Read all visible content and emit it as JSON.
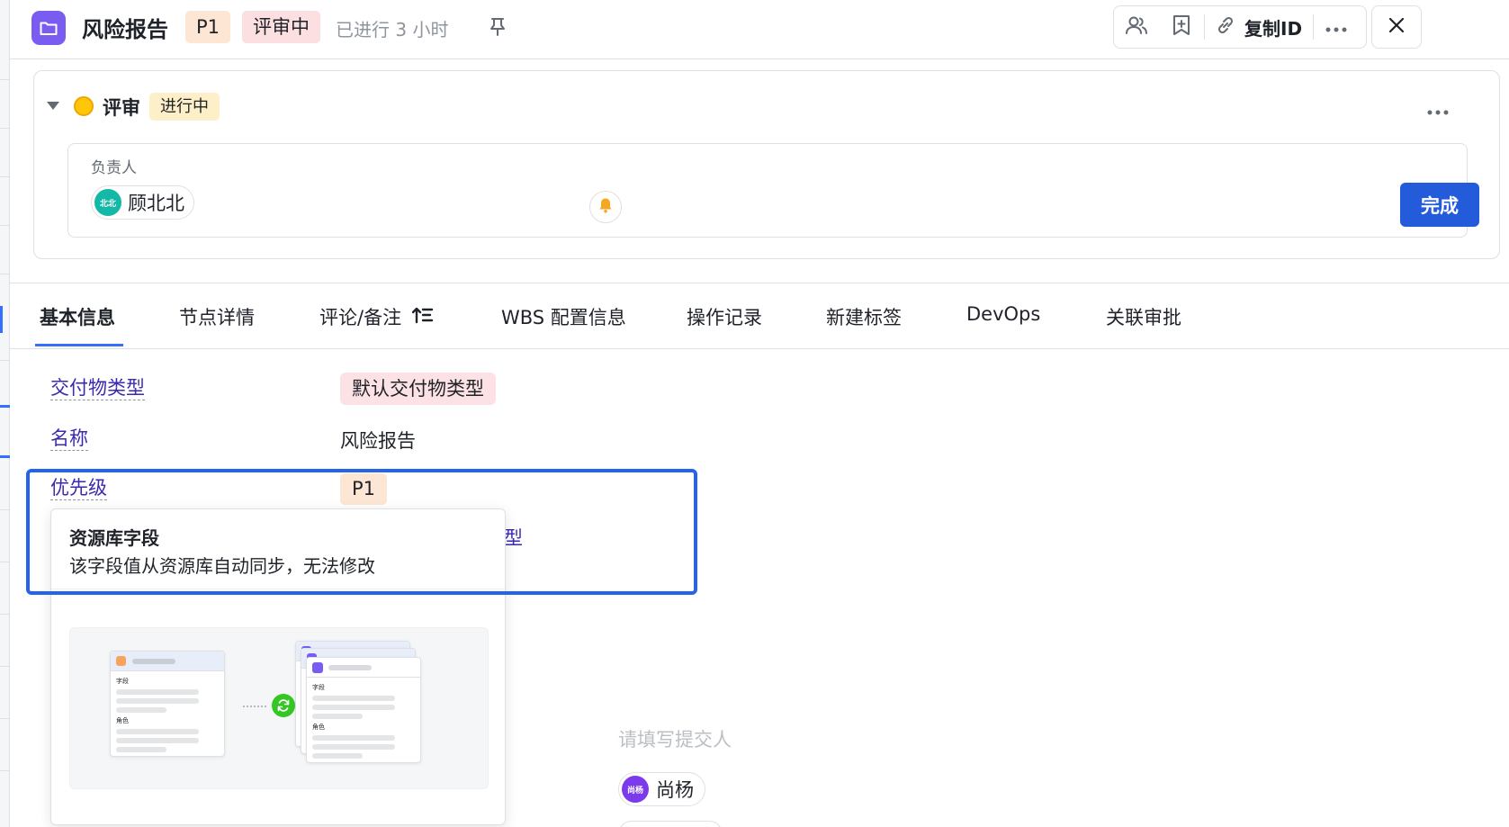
{
  "header": {
    "title": "风险报告",
    "priority": "P1",
    "status": "评审中",
    "elapsed": "已进行 3 小时",
    "copy_id_label": "复制ID"
  },
  "review": {
    "name": "评审",
    "state": "进行中",
    "owner_label": "负责人",
    "owner": {
      "avatar_text": "北北",
      "name": "顾北北"
    },
    "done_label": "完成"
  },
  "tabs": [
    {
      "label": "基本信息",
      "active": true
    },
    {
      "label": "节点详情"
    },
    {
      "label": "评论/备注"
    },
    {
      "label": "WBS 配置信息"
    },
    {
      "label": "操作记录"
    },
    {
      "label": "新建标签"
    },
    {
      "label": "DevOps"
    },
    {
      "label": "关联审批"
    }
  ],
  "fields": {
    "deliverable_type": {
      "label": "交付物类型",
      "value": "默认交付物类型"
    },
    "name": {
      "label": "名称",
      "value": "风险报告"
    },
    "priority": {
      "label": "优先级",
      "value": "P1"
    },
    "partial_label": "型"
  },
  "tooltip": {
    "title": "资源库字段",
    "description": "该字段值从资源库自动同步，无法修改",
    "illustration": {
      "field_text": "字段",
      "role_text": "角色"
    }
  },
  "submitter": {
    "placeholder": "请填写提交人",
    "person": {
      "avatar_text": "尚杨",
      "name": "尚杨"
    }
  },
  "colors": {
    "accent": "#245bdb",
    "highlight": "#2563eb",
    "status_yellow": "#ffc60a",
    "app_icon": "#7b5cf0"
  }
}
